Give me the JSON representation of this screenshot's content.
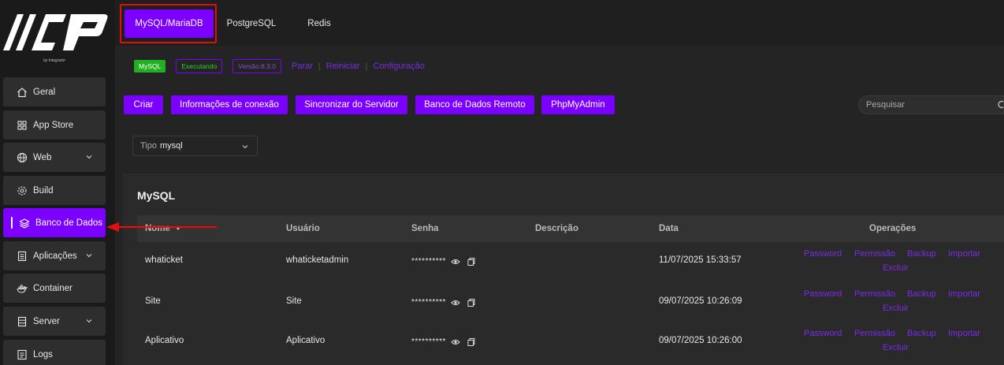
{
  "logo": {
    "sub": "by Integrator"
  },
  "sidebar": {
    "items": [
      {
        "label": "Geral"
      },
      {
        "label": "App Store"
      },
      {
        "label": "Web"
      },
      {
        "label": "Build"
      },
      {
        "label": "Banco de Dados"
      },
      {
        "label": "Aplicações"
      },
      {
        "label": "Container"
      },
      {
        "label": "Server"
      },
      {
        "label": "Logs"
      }
    ]
  },
  "tabs": [
    {
      "label": "MySQL/MariaDB"
    },
    {
      "label": "PostgreSQL"
    },
    {
      "label": "Redis"
    }
  ],
  "status": {
    "db_badge": "MySQL",
    "running": "Executando",
    "version": "Versão:8.3.0",
    "stop": "Parar",
    "restart": "Reiniciar",
    "config": "Configuração"
  },
  "toolbar": {
    "create": "Criar",
    "connection_info": "Informações de conexão",
    "sync_server": "Sincronizar do Servidor",
    "remote_db": "Banco de Dados Remoto",
    "phpmyadmin": "PhpMyAdmin"
  },
  "search": {
    "placeholder": "Pesquisar"
  },
  "type_filter": {
    "label": "Tipo",
    "value": "mysql"
  },
  "panel": {
    "title": "MySQL"
  },
  "table": {
    "columns": [
      "Nome",
      "Usuário",
      "Senha",
      "Descrição",
      "Data",
      "Operações"
    ],
    "rows": [
      {
        "name": "whaticket",
        "user": "whaticketadmin",
        "password": "**********",
        "description": "",
        "date": "11/07/2025 15:33:57"
      },
      {
        "name": "Site",
        "user": "Site",
        "password": "**********",
        "description": "",
        "date": "09/07/2025 10:26:09"
      },
      {
        "name": "Aplicativo",
        "user": "Aplicativo",
        "password": "**********",
        "description": "",
        "date": "09/07/2025 10:26:00"
      }
    ],
    "operations": {
      "password": "Password",
      "permission": "Permissão",
      "backup": "Backup",
      "import": "Importar",
      "delete": "Excluir"
    }
  },
  "colors": {
    "accent": "#7b00ff",
    "running_green": "#22b022",
    "highlight_red": "#e01010"
  }
}
